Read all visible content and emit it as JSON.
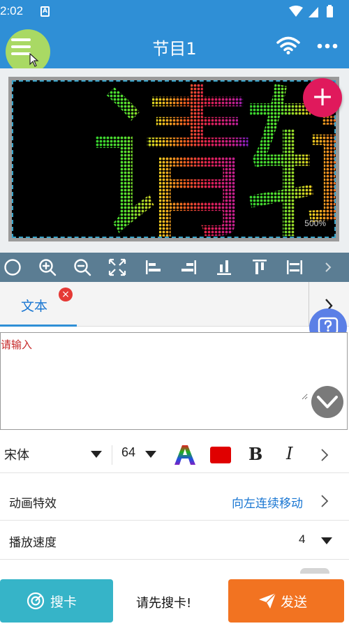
{
  "status_bar": {
    "time": "2:02",
    "app_badge": "A"
  },
  "app_bar": {
    "title": "节目1"
  },
  "preview": {
    "zoom": "500%",
    "characters": [
      "请",
      "辑"
    ],
    "colors": {
      "frame": "#9a9a9a",
      "guide": "#37a3c9",
      "add": "#e0195c"
    }
  },
  "toolbar": {
    "icons": [
      "circle-icon",
      "zoom-in-icon",
      "zoom-out-icon",
      "fit-screen-icon",
      "align-left-icon",
      "align-right-icon",
      "align-bottom-icon",
      "align-top-icon",
      "fit-width-icon",
      "chevron-right-icon"
    ]
  },
  "tabs": [
    {
      "label": "文本",
      "closable": true,
      "active": true
    }
  ],
  "editor": {
    "placeholder": "请输入",
    "value": ""
  },
  "format": {
    "font": "宋体",
    "size": "64",
    "bold": "B",
    "italic": "I",
    "text_color": "#e00000"
  },
  "settings": {
    "animation": {
      "label": "动画特效",
      "value": "向左连续移动"
    },
    "speed": {
      "label": "播放速度",
      "value": "4"
    }
  },
  "bottom": {
    "search_button": "搜卡",
    "status": "请先搜卡!",
    "send_button": "发送"
  },
  "colors": {
    "primary": "#2f8fd6",
    "search": "#36b4c8",
    "send": "#f27321"
  }
}
